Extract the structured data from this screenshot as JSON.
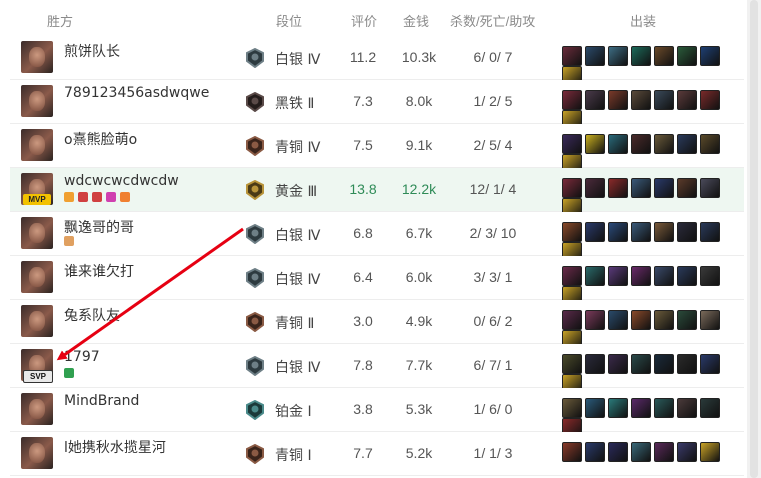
{
  "header": {
    "team": "胜方",
    "tier": "段位",
    "rating": "评价",
    "gold": "金钱",
    "kda": "杀数/死亡/助攻",
    "items": "出装"
  },
  "colors": {
    "mvp_row_bg": "#eef7f1",
    "mvp_value": "#2e8b57",
    "arrow": "#e60012"
  },
  "players": [
    {
      "name": "煎饼队长",
      "tier": "白银 Ⅳ",
      "tier_icon": "silver-emblem-icon",
      "rating": "11.2",
      "gold": "10.3k",
      "kda": "6/ 0/ 7",
      "badge": "",
      "tags": [],
      "items": [
        "#6a2c3b",
        "#2b4a6a",
        "#3d6d84",
        "#1d6b5b",
        "#6b4a2a",
        "#2a5a3a",
        "#1e3f73",
        "#c9a326"
      ]
    },
    {
      "name": "789123456asdwqwe",
      "tier": "黑铁 Ⅱ",
      "tier_icon": "iron-emblem-icon",
      "rating": "7.3",
      "gold": "8.0k",
      "kda": "1/ 2/ 5",
      "badge": "",
      "tags": [],
      "items": [
        "#7a2a3a",
        "#4a3a4a",
        "#7a3a2a",
        "#5a4a3a",
        "#3a4a5a",
        "#5a3a3a",
        "#7a2a2a",
        "#c9a326"
      ]
    },
    {
      "name": "o熹熊脸萌o",
      "tier": "青铜 Ⅳ",
      "tier_icon": "bronze-emblem-icon",
      "rating": "7.5",
      "gold": "9.1k",
      "kda": "2/ 5/ 4",
      "badge": "",
      "tags": [],
      "items": [
        "#3a2a5a",
        "#c9b020",
        "#2a6a7a",
        "#4a2a2a",
        "#6a5a3a",
        "#2a3a5a",
        "#5a4a2a",
        "#c9a326"
      ]
    },
    {
      "name": "wdcwcwcdwcdw",
      "tier": "黄金 Ⅲ",
      "tier_icon": "gold-emblem-icon",
      "rating": "13.8",
      "gold": "12.2k",
      "kda": "12/ 1/ 4",
      "badge": "MVP",
      "mvp": true,
      "tags": [
        "#f0a030",
        "#d04040",
        "#d04040",
        "#d040b0",
        "#f08030"
      ],
      "items": [
        "#7a2a3a",
        "#4a2a3a",
        "#8a2a2a",
        "#3a5a7a",
        "#2a3a6a",
        "#5a3a2a",
        "#4a4a5a",
        "#c9a326"
      ]
    },
    {
      "name": "飘逸哥的哥",
      "tier": "白银 Ⅳ",
      "tier_icon": "silver-emblem-icon",
      "rating": "6.8",
      "gold": "6.7k",
      "kda": "2/ 3/ 10",
      "badge": "",
      "tags": [
        "#e0a060"
      ],
      "items": [
        "#8a4a2a",
        "#2a3a6a",
        "#2a4a7a",
        "#3a5a7a",
        "#7a5a3a",
        "#2a2a3a",
        "#2a3a5a",
        "#c9a326"
      ]
    },
    {
      "name": "谁来谁欠打",
      "tier": "白银 Ⅳ",
      "tier_icon": "silver-emblem-icon",
      "rating": "6.4",
      "gold": "6.0k",
      "kda": "3/ 3/ 1",
      "badge": "",
      "tags": [],
      "items": [
        "#6a2a4a",
        "#2a6a6a",
        "#5a3a7a",
        "#6a2a6a",
        "#3a4a6a",
        "#2a3a5a",
        "#3a3a3a",
        "#c9a326"
      ]
    },
    {
      "name": "兔系队友",
      "tier": "青铜 Ⅱ",
      "tier_icon": "bronze-emblem-icon",
      "rating": "3.0",
      "gold": "4.9k",
      "kda": "0/ 6/ 2",
      "badge": "",
      "tags": [],
      "items": [
        "#5a2a4a",
        "#7a3a5a",
        "#2a4a6a",
        "#8a4a2a",
        "#6a5a3a",
        "#2a4a3a",
        "#7a6a5a",
        "#c9a326"
      ]
    },
    {
      "name": "1797",
      "tier": "白银 Ⅳ",
      "tier_icon": "silver-emblem-icon",
      "rating": "7.8",
      "gold": "7.7k",
      "kda": "6/ 7/ 1",
      "badge": "SVP",
      "tags": [
        "#30a050"
      ],
      "items": [
        "#4a4a2a",
        "#2a2a3a",
        "#3a2a4a",
        "#2a4a4a",
        "#1a2a3a",
        "#2a2a2a",
        "#2a3a6a",
        "#c9a326"
      ]
    },
    {
      "name": "MindBrand",
      "tier": "铂金 Ⅰ",
      "tier_icon": "platinum-emblem-icon",
      "rating": "3.8",
      "gold": "5.3k",
      "kda": "1/ 6/ 0",
      "badge": "",
      "tags": [],
      "items": [
        "#6a5a3a",
        "#2a5a7a",
        "#2a7a7a",
        "#5a2a6a",
        "#2a5a5a",
        "#4a3a3a",
        "#2a3a3a",
        "#8a2a2a"
      ]
    },
    {
      "name": "l她携秋水揽星河",
      "tier": "青铜 Ⅰ",
      "tier_icon": "bronze-emblem-icon",
      "rating": "7.7",
      "gold": "5.2k",
      "kda": "1/ 1/ 3",
      "badge": "",
      "tags": [],
      "items": [
        "#8a3a2a",
        "#2a3a6a",
        "#2a2a5a",
        "#3a6a7a",
        "#5a2a5a",
        "#3a3a6a",
        "#c9a326"
      ]
    }
  ]
}
